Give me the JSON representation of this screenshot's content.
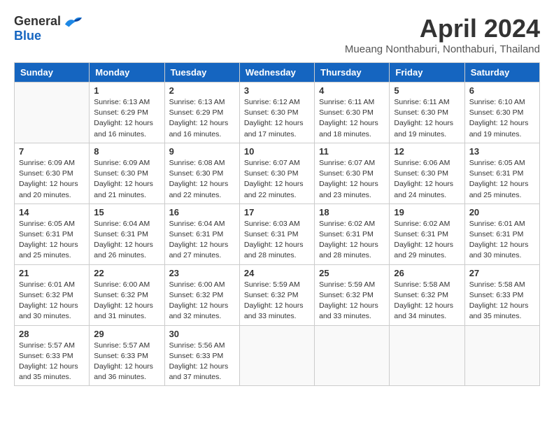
{
  "header": {
    "logo": {
      "general": "General",
      "blue": "Blue"
    },
    "title": "April 2024",
    "location": "Mueang Nonthaburi, Nonthaburi, Thailand"
  },
  "calendar": {
    "days_of_week": [
      "Sunday",
      "Monday",
      "Tuesday",
      "Wednesday",
      "Thursday",
      "Friday",
      "Saturday"
    ],
    "weeks": [
      [
        {
          "day": "",
          "info": ""
        },
        {
          "day": "1",
          "info": "Sunrise: 6:13 AM\nSunset: 6:29 PM\nDaylight: 12 hours\nand 16 minutes."
        },
        {
          "day": "2",
          "info": "Sunrise: 6:13 AM\nSunset: 6:29 PM\nDaylight: 12 hours\nand 16 minutes."
        },
        {
          "day": "3",
          "info": "Sunrise: 6:12 AM\nSunset: 6:30 PM\nDaylight: 12 hours\nand 17 minutes."
        },
        {
          "day": "4",
          "info": "Sunrise: 6:11 AM\nSunset: 6:30 PM\nDaylight: 12 hours\nand 18 minutes."
        },
        {
          "day": "5",
          "info": "Sunrise: 6:11 AM\nSunset: 6:30 PM\nDaylight: 12 hours\nand 19 minutes."
        },
        {
          "day": "6",
          "info": "Sunrise: 6:10 AM\nSunset: 6:30 PM\nDaylight: 12 hours\nand 19 minutes."
        }
      ],
      [
        {
          "day": "7",
          "info": "Sunrise: 6:09 AM\nSunset: 6:30 PM\nDaylight: 12 hours\nand 20 minutes."
        },
        {
          "day": "8",
          "info": "Sunrise: 6:09 AM\nSunset: 6:30 PM\nDaylight: 12 hours\nand 21 minutes."
        },
        {
          "day": "9",
          "info": "Sunrise: 6:08 AM\nSunset: 6:30 PM\nDaylight: 12 hours\nand 22 minutes."
        },
        {
          "day": "10",
          "info": "Sunrise: 6:07 AM\nSunset: 6:30 PM\nDaylight: 12 hours\nand 22 minutes."
        },
        {
          "day": "11",
          "info": "Sunrise: 6:07 AM\nSunset: 6:30 PM\nDaylight: 12 hours\nand 23 minutes."
        },
        {
          "day": "12",
          "info": "Sunrise: 6:06 AM\nSunset: 6:30 PM\nDaylight: 12 hours\nand 24 minutes."
        },
        {
          "day": "13",
          "info": "Sunrise: 6:05 AM\nSunset: 6:31 PM\nDaylight: 12 hours\nand 25 minutes."
        }
      ],
      [
        {
          "day": "14",
          "info": "Sunrise: 6:05 AM\nSunset: 6:31 PM\nDaylight: 12 hours\nand 25 minutes."
        },
        {
          "day": "15",
          "info": "Sunrise: 6:04 AM\nSunset: 6:31 PM\nDaylight: 12 hours\nand 26 minutes."
        },
        {
          "day": "16",
          "info": "Sunrise: 6:04 AM\nSunset: 6:31 PM\nDaylight: 12 hours\nand 27 minutes."
        },
        {
          "day": "17",
          "info": "Sunrise: 6:03 AM\nSunset: 6:31 PM\nDaylight: 12 hours\nand 28 minutes."
        },
        {
          "day": "18",
          "info": "Sunrise: 6:02 AM\nSunset: 6:31 PM\nDaylight: 12 hours\nand 28 minutes."
        },
        {
          "day": "19",
          "info": "Sunrise: 6:02 AM\nSunset: 6:31 PM\nDaylight: 12 hours\nand 29 minutes."
        },
        {
          "day": "20",
          "info": "Sunrise: 6:01 AM\nSunset: 6:31 PM\nDaylight: 12 hours\nand 30 minutes."
        }
      ],
      [
        {
          "day": "21",
          "info": "Sunrise: 6:01 AM\nSunset: 6:32 PM\nDaylight: 12 hours\nand 30 minutes."
        },
        {
          "day": "22",
          "info": "Sunrise: 6:00 AM\nSunset: 6:32 PM\nDaylight: 12 hours\nand 31 minutes."
        },
        {
          "day": "23",
          "info": "Sunrise: 6:00 AM\nSunset: 6:32 PM\nDaylight: 12 hours\nand 32 minutes."
        },
        {
          "day": "24",
          "info": "Sunrise: 5:59 AM\nSunset: 6:32 PM\nDaylight: 12 hours\nand 33 minutes."
        },
        {
          "day": "25",
          "info": "Sunrise: 5:59 AM\nSunset: 6:32 PM\nDaylight: 12 hours\nand 33 minutes."
        },
        {
          "day": "26",
          "info": "Sunrise: 5:58 AM\nSunset: 6:32 PM\nDaylight: 12 hours\nand 34 minutes."
        },
        {
          "day": "27",
          "info": "Sunrise: 5:58 AM\nSunset: 6:33 PM\nDaylight: 12 hours\nand 35 minutes."
        }
      ],
      [
        {
          "day": "28",
          "info": "Sunrise: 5:57 AM\nSunset: 6:33 PM\nDaylight: 12 hours\nand 35 minutes."
        },
        {
          "day": "29",
          "info": "Sunrise: 5:57 AM\nSunset: 6:33 PM\nDaylight: 12 hours\nand 36 minutes."
        },
        {
          "day": "30",
          "info": "Sunrise: 5:56 AM\nSunset: 6:33 PM\nDaylight: 12 hours\nand 37 minutes."
        },
        {
          "day": "",
          "info": ""
        },
        {
          "day": "",
          "info": ""
        },
        {
          "day": "",
          "info": ""
        },
        {
          "day": "",
          "info": ""
        }
      ]
    ]
  }
}
